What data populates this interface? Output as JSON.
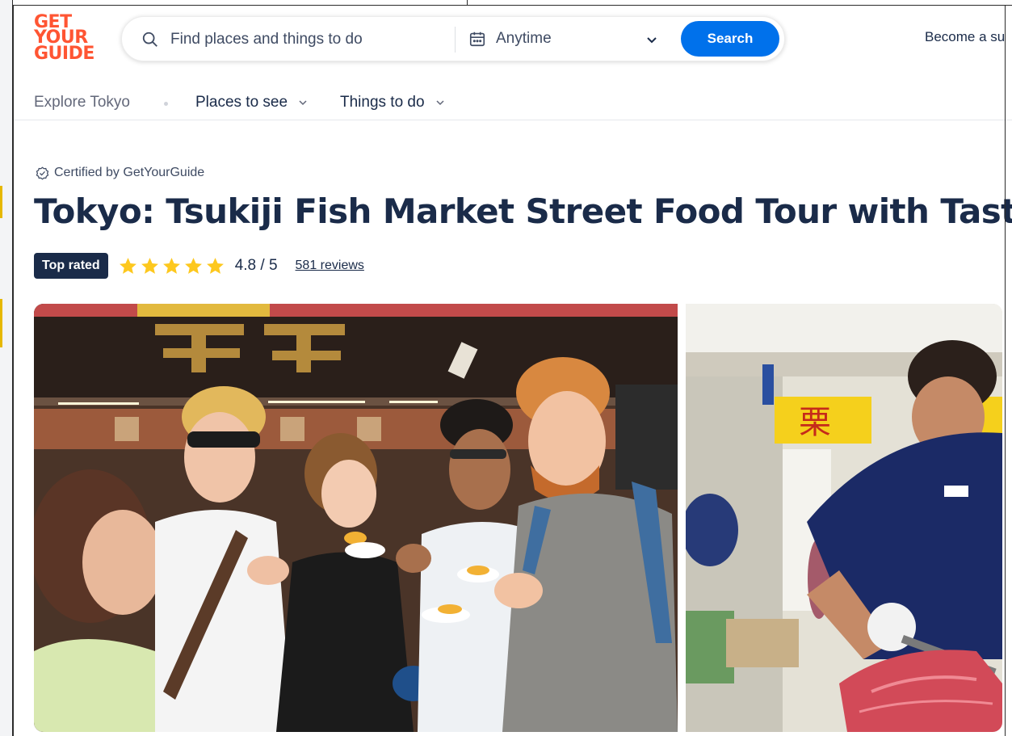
{
  "logo": {
    "line1": "GET",
    "line2": "YOUR",
    "line3": "GUIDE"
  },
  "search": {
    "placeholder": "Find places and things to do",
    "date_label": "Anytime",
    "button_label": "Search"
  },
  "header": {
    "become_link": "Become a su"
  },
  "subnav": {
    "explore": "Explore Tokyo",
    "places": "Places to see",
    "things": "Things to do"
  },
  "product": {
    "certified": "Certified by GetYourGuide",
    "title": "Tokyo: Tsukiji Fish Market Street Food Tour with Tasting",
    "badge": "Top rated",
    "rating": "4.8 / 5",
    "stars_filled": 5,
    "reviews": "581 reviews"
  },
  "colors": {
    "brand_orange": "#ff5533",
    "primary_blue": "#0071eb",
    "navy": "#1a2b49",
    "star_yellow": "#fdc81e"
  },
  "icons": [
    "search-icon",
    "calendar-icon",
    "chevron-down-icon",
    "certified-check-icon",
    "star-icon"
  ]
}
